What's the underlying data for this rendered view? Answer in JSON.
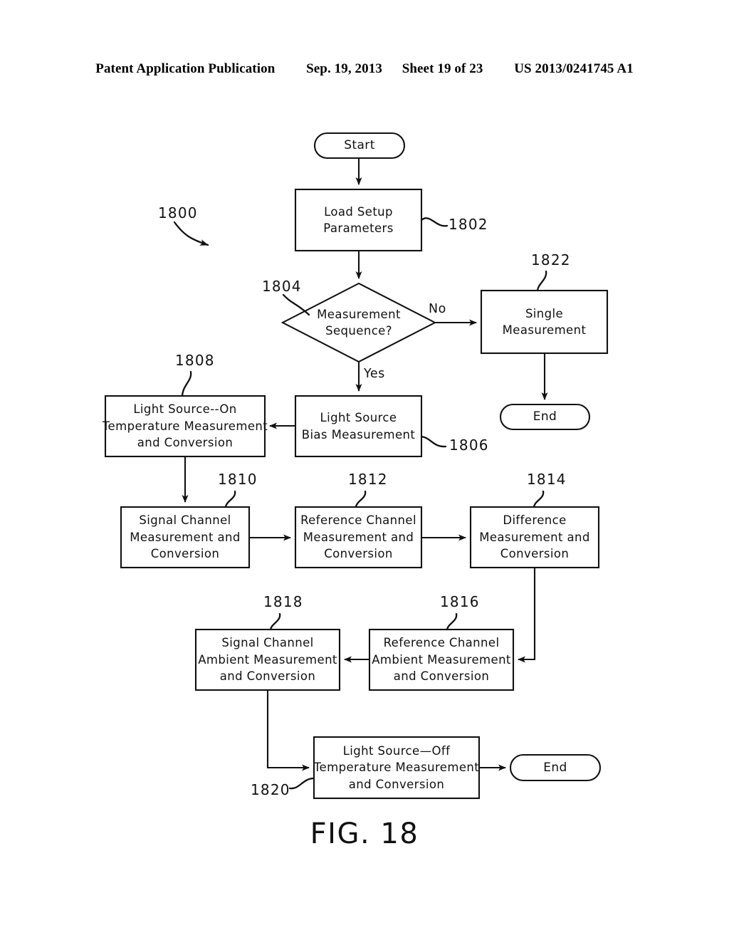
{
  "header": {
    "publication": "Patent Application Publication",
    "date": "Sep. 19, 2013",
    "sheet": "Sheet 19 of 23",
    "patent_number": "US 2013/0241745 A1"
  },
  "figure": {
    "caption": "FIG. 18",
    "diagram_id": "1800"
  },
  "branch_labels": {
    "no": "No",
    "yes": "Yes"
  },
  "nodes": [
    {
      "id": "start",
      "ref": "",
      "shape": "terminator",
      "lines": [
        "Start"
      ]
    },
    {
      "id": "load-setup-parameters",
      "ref": "1802",
      "shape": "process",
      "lines": [
        "Load  Setup",
        "Parameters"
      ]
    },
    {
      "id": "measurement-sequence-decision",
      "ref": "1804",
      "shape": "decision",
      "lines": [
        "Measurement",
        "Sequence?"
      ]
    },
    {
      "id": "single-measurement",
      "ref": "1822",
      "shape": "process",
      "lines": [
        "Single",
        "Measurement"
      ]
    },
    {
      "id": "end-single",
      "ref": "",
      "shape": "terminator",
      "lines": [
        "End"
      ]
    },
    {
      "id": "light-source-bias-measurement",
      "ref": "1806",
      "shape": "process",
      "lines": [
        "Light  Source",
        "Bias  Measurement"
      ]
    },
    {
      "id": "light-source-on-temperature",
      "ref": "1808",
      "shape": "process",
      "lines": [
        "Light  Source--On",
        "Temperature  Measurement",
        "and  Conversion"
      ]
    },
    {
      "id": "signal-channel-measurement",
      "ref": "1810",
      "shape": "process",
      "lines": [
        "Signal  Channel",
        "Measurement  and",
        "Conversion"
      ]
    },
    {
      "id": "reference-channel-measurement",
      "ref": "1812",
      "shape": "process",
      "lines": [
        "Reference  Channel",
        "Measurement  and",
        "Conversion"
      ]
    },
    {
      "id": "difference-measurement",
      "ref": "1814",
      "shape": "process",
      "lines": [
        "Difference",
        "Measurement  and",
        "Conversion"
      ]
    },
    {
      "id": "reference-channel-ambient",
      "ref": "1816",
      "shape": "process",
      "lines": [
        "Reference  Channel",
        "Ambient  Measurement",
        "and  Conversion"
      ]
    },
    {
      "id": "signal-channel-ambient",
      "ref": "1818",
      "shape": "process",
      "lines": [
        "Signal  Channel",
        "Ambient  Measurement",
        "and  Conversion"
      ]
    },
    {
      "id": "light-source-off-temperature",
      "ref": "1820",
      "shape": "process",
      "lines": [
        "Light  Source—Off",
        "Temperature  Measurement",
        "and  Conversion"
      ]
    },
    {
      "id": "end-sequence",
      "ref": "",
      "shape": "terminator",
      "lines": [
        "End"
      ]
    }
  ],
  "text": {
    "start": "Start",
    "load_setup_l1": "Load  Setup",
    "load_setup_l2": "Parameters",
    "decision_l1": "Measurement",
    "decision_l2": "Sequence?",
    "single_l1": "Single",
    "single_l2": "Measurement",
    "end_single": "End",
    "bias_l1": "Light  Source",
    "bias_l2": "Bias  Measurement",
    "lson_l1": "Light  Source--On",
    "lson_l2": "Temperature  Measurement",
    "lson_l3": "and  Conversion",
    "sigch_l1": "Signal  Channel",
    "sigch_l2": "Measurement  and",
    "sigch_l3": "Conversion",
    "refch_l1": "Reference  Channel",
    "refch_l2": "Measurement  and",
    "refch_l3": "Conversion",
    "diff_l1": "Difference",
    "diff_l2": "Measurement  and",
    "diff_l3": "Conversion",
    "refamb_l1": "Reference  Channel",
    "refamb_l2": "Ambient  Measurement",
    "refamb_l3": "and  Conversion",
    "sigamb_l1": "Signal  Channel",
    "sigamb_l2": "Ambient  Measurement",
    "sigamb_l3": "and  Conversion",
    "lsoff_l1": "Light  Source—Off",
    "lsoff_l2": "Temperature  Measurement",
    "lsoff_l3": "and  Conversion",
    "end_sequence": "End"
  },
  "refs": {
    "r1800": "1800",
    "r1802": "1802",
    "r1804": "1804",
    "r1806": "1806",
    "r1808": "1808",
    "r1810": "1810",
    "r1812": "1812",
    "r1814": "1814",
    "r1816": "1816",
    "r1818": "1818",
    "r1820": "1820",
    "r1822": "1822"
  },
  "colors": {
    "ink": "#111111",
    "paper": "#ffffff"
  }
}
